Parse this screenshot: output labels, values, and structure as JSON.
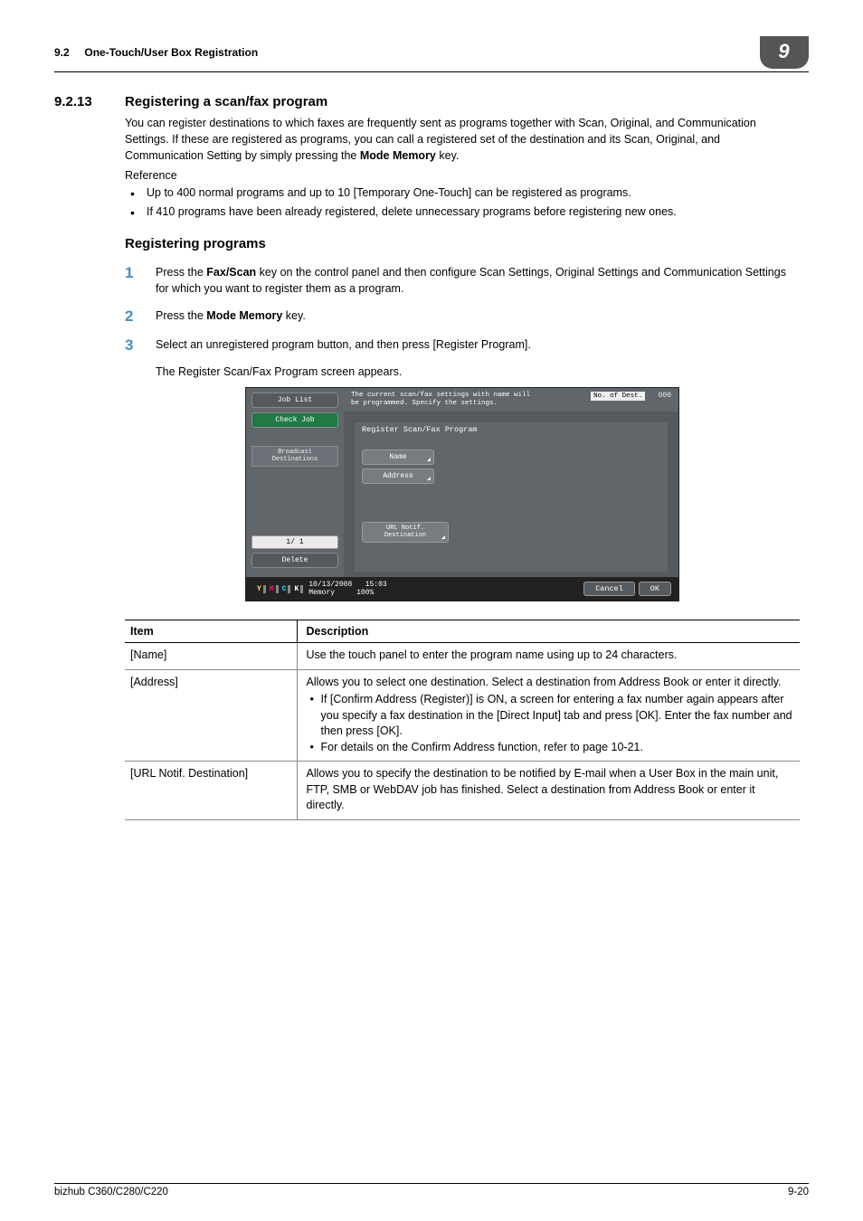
{
  "header": {
    "section_ref": "9.2",
    "breadcrumb": "One-Touch/User Box Registration",
    "chapter_badge": "9"
  },
  "section": {
    "number": "9.2.13",
    "title": "Registering a scan/fax program",
    "intro_a": "You can register destinations to which faxes are frequently sent as programs together with Scan, Original, and Communication Settings. If these are registered as programs, you can call a registered set of the destination and its Scan, Original, and Communication Setting by simply pressing the ",
    "intro_key": "Mode Memory",
    "intro_b": " key.",
    "reference_label": "Reference",
    "reference_bullets": [
      "Up to 400 normal programs and up to 10 [Temporary One-Touch] can be registered as programs.",
      "If 410 programs have been already registered, delete unnecessary programs before registering new ones."
    ],
    "subhead": "Registering programs",
    "steps": [
      {
        "num": "1",
        "pre": "Press the ",
        "key": "Fax/Scan",
        "post": " key on the control panel and then configure Scan Settings, Original Settings and Communication Settings for which you want to register them as a program."
      },
      {
        "num": "2",
        "pre": "Press the ",
        "key": "Mode Memory",
        "post": " key."
      },
      {
        "num": "3",
        "pre": "Select an unregistered program button, and then press [Register Program].",
        "key": "",
        "post": ""
      }
    ],
    "step3_extra": "The Register Scan/Fax Program screen appears."
  },
  "screenshot": {
    "job_list": "Job List",
    "check_job": "Check Job",
    "broadcast": "Broadcast Destinations",
    "paginate": "1/  1",
    "delete": "Delete",
    "prompt_line1": "The current scan/fax settings with name will",
    "prompt_line2": "be programmed. Specify the settings.",
    "dest_label": "No. of Dest.",
    "dest_count": "000",
    "panel_title": "Register Scan/Fax Program",
    "field_name": "Name",
    "field_address": "Address",
    "field_url": "URL Notif. Destination",
    "date": "10/13/2008",
    "time": "15:03",
    "memory": "Memory",
    "memory_pct": "100%",
    "cancel": "Cancel",
    "ok": "OK",
    "toner": {
      "y": "Y",
      "m": "M",
      "c": "C",
      "k": "K"
    }
  },
  "table": {
    "head_item": "Item",
    "head_desc": "Description",
    "rows": [
      {
        "item": "[Name]",
        "desc": "Use the touch panel to enter the program name using up to 24 characters."
      },
      {
        "item": "[Address]",
        "desc": "Allows you to select one destination. Select a destination from Address Book or enter it directly.",
        "bullets": [
          "If [Confirm Address (Register)] is ON, a screen for entering a fax number again appears after you specify a fax destination in the [Direct Input] tab and press [OK]. Enter the fax number and then press [OK].",
          "For details on the Confirm Address function, refer to page 10-21."
        ]
      },
      {
        "item": "[URL Notif. Destination]",
        "desc": "Allows you to specify the destination to be notified by E-mail when a User Box in the main unit, FTP, SMB or WebDAV job has finished. Select a destination from Address Book or enter it directly."
      }
    ]
  },
  "footer": {
    "model": "bizhub C360/C280/C220",
    "page": "9-20"
  }
}
